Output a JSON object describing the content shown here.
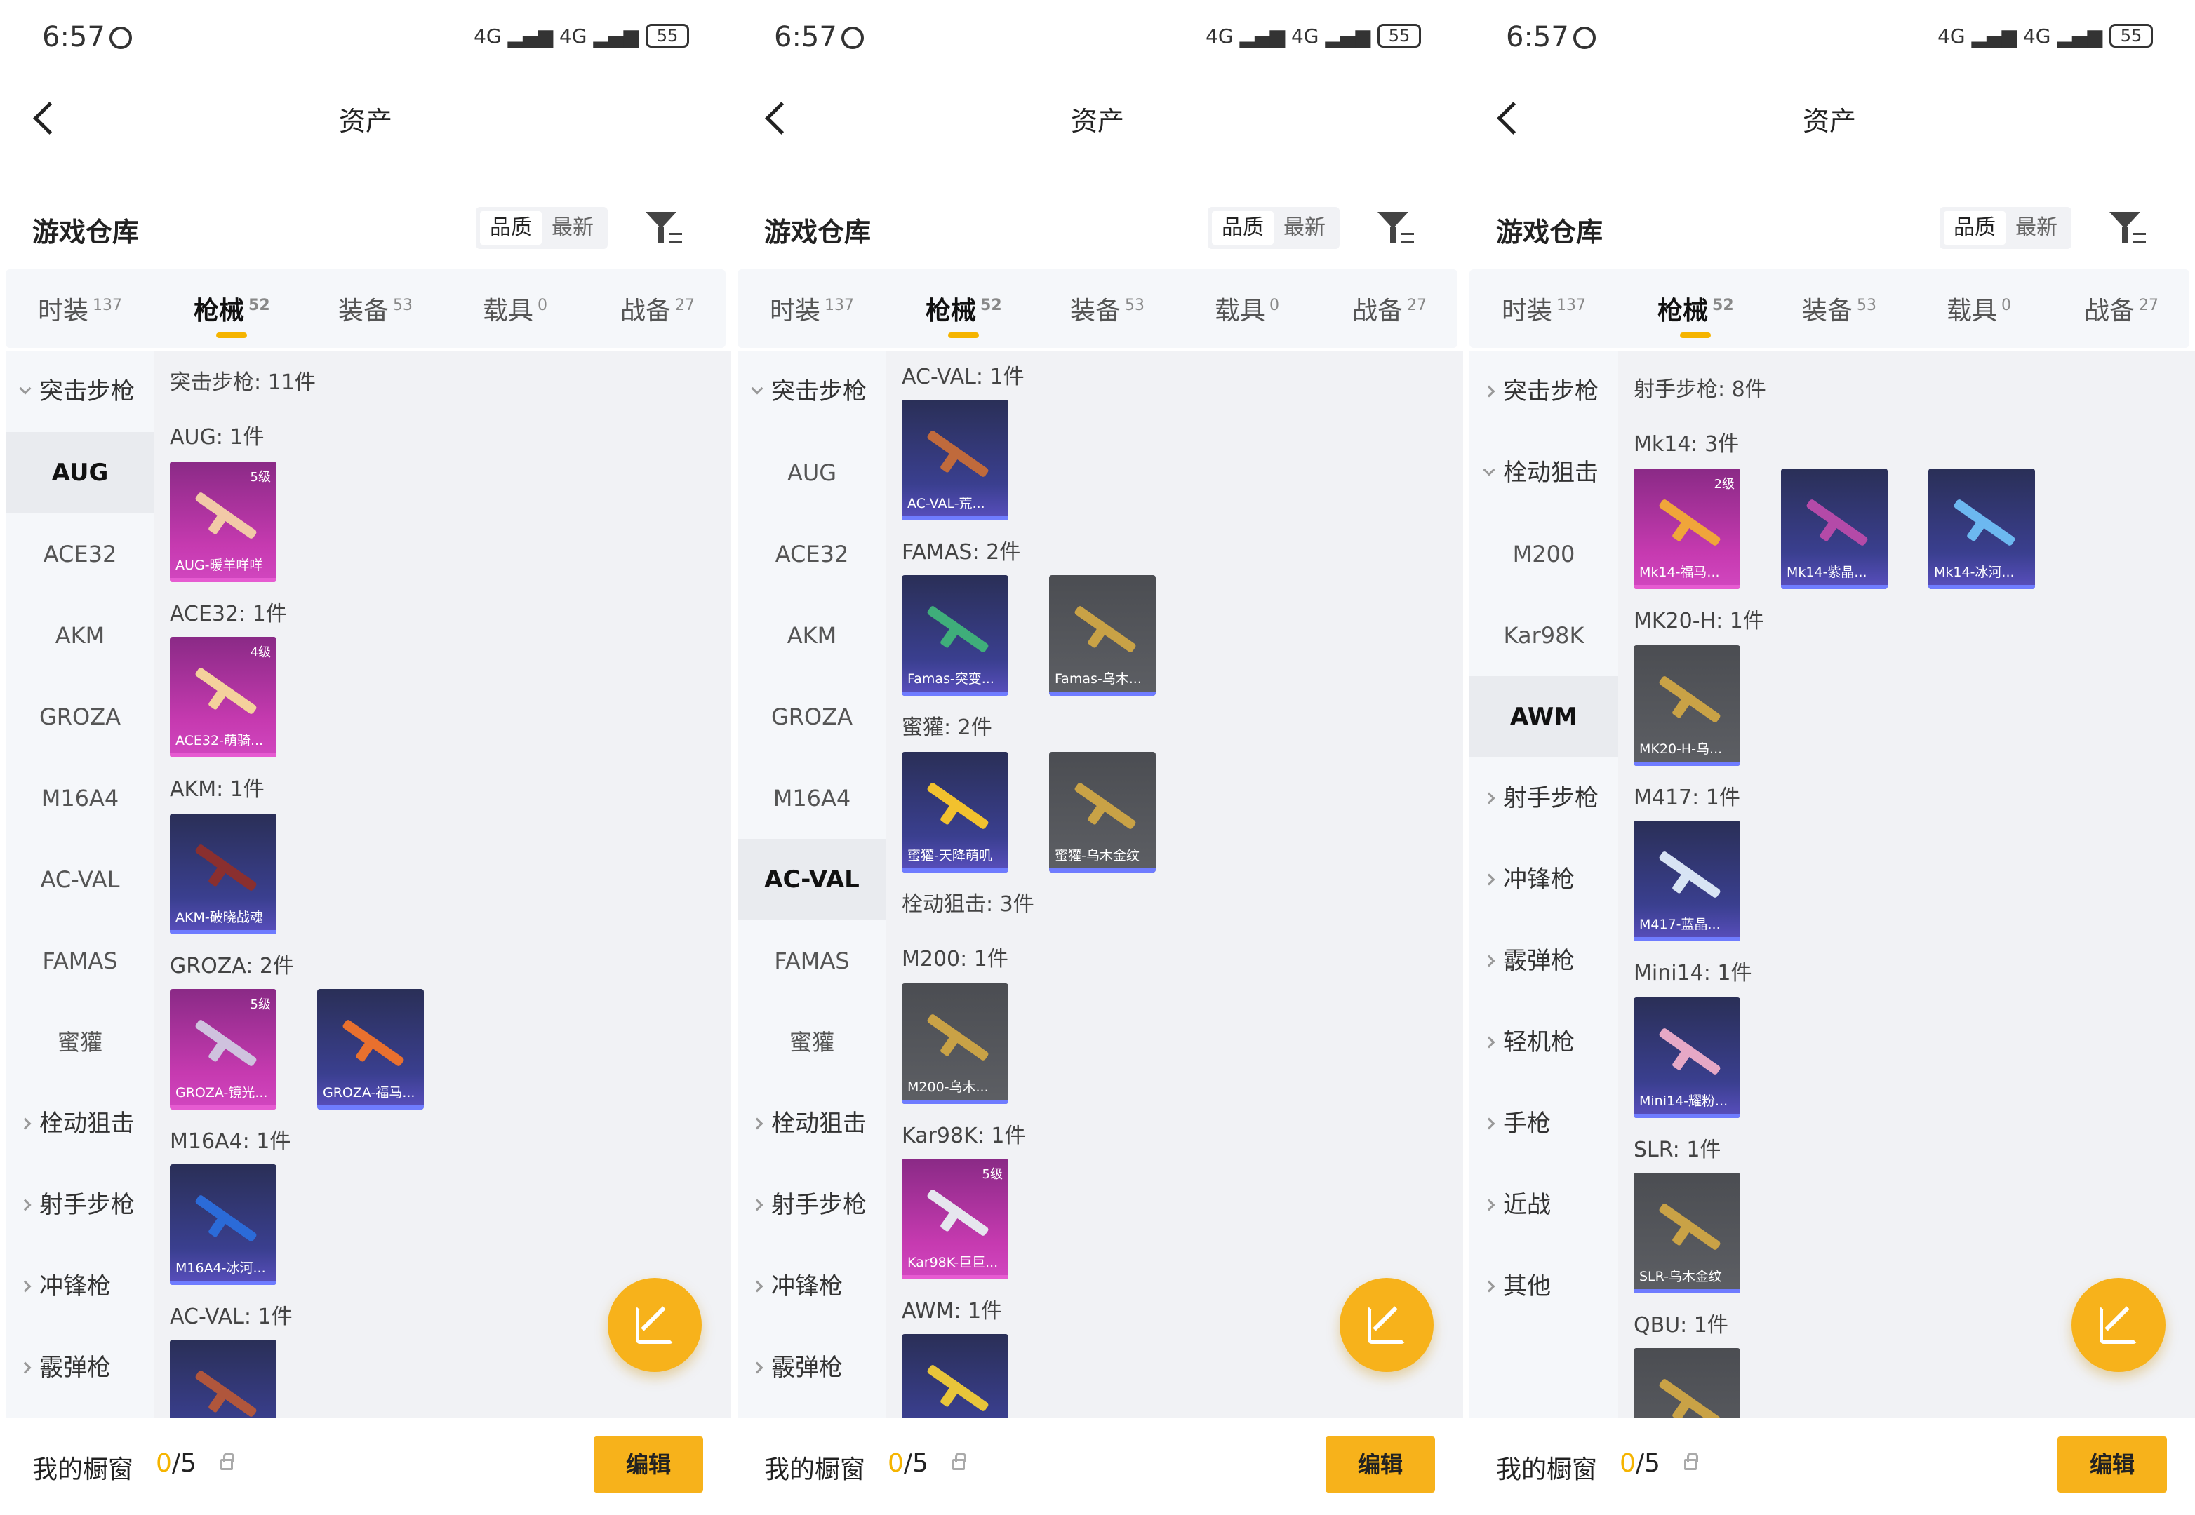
{
  "status": {
    "time": "6:57",
    "battery": "55",
    "signal": "4G ▂▄▆ 4G ▂▄▆"
  },
  "header": {
    "title": "资产"
  },
  "warehouse": {
    "title": "游戏仓库",
    "sort_quality": "品质",
    "sort_newest": "最新"
  },
  "tabs": [
    {
      "label": "时装",
      "count": "137"
    },
    {
      "label": "枪械",
      "count": "52"
    },
    {
      "label": "装备",
      "count": "53"
    },
    {
      "label": "载具",
      "count": "0"
    },
    {
      "label": "战备",
      "count": "27"
    }
  ],
  "footer": {
    "showcase": "我的橱窗",
    "count_current": "0",
    "count_total": "/5",
    "edit": "编辑"
  },
  "panels": [
    {
      "sidebar": [
        "突击步枪",
        "AUG",
        "ACE32",
        "AKM",
        "GROZA",
        "M16A4",
        "AC-VAL",
        "FAMAS",
        "蜜獾",
        "栓动狙击",
        "射手步枪",
        "冲锋枪",
        "霰弹枪"
      ],
      "content": {
        "section": "突击步枪: 11件",
        "groups": [
          {
            "label": "AUG: 1件",
            "cards": [
              {
                "name": "AUG-暖羊咩咩",
                "level": "5级"
              }
            ]
          },
          {
            "label": "ACE32: 1件",
            "cards": [
              {
                "name": "ACE32-萌骑...",
                "level": "4级"
              }
            ]
          },
          {
            "label": "AKM: 1件",
            "cards": [
              {
                "name": "AKM-破晓战魂",
                "level": ""
              }
            ]
          },
          {
            "label": "GROZA: 2件",
            "cards": [
              {
                "name": "GROZA-镜光...",
                "level": "5级"
              },
              {
                "name": "GROZA-福马...",
                "level": ""
              }
            ]
          },
          {
            "label": "M16A4: 1件",
            "cards": [
              {
                "name": "M16A4-冰河...",
                "level": ""
              }
            ]
          },
          {
            "label": "AC-VAL: 1件",
            "cards": [
              {
                "name": "",
                "level": ""
              }
            ]
          }
        ]
      }
    },
    {
      "sidebar": [
        "突击步枪",
        "AUG",
        "ACE32",
        "AKM",
        "GROZA",
        "M16A4",
        "AC-VAL",
        "FAMAS",
        "蜜獾",
        "栓动狙击",
        "射手步枪",
        "冲锋枪",
        "霰弹枪"
      ],
      "content": {
        "groups": [
          {
            "label": "AC-VAL: 1件",
            "cards": [
              {
                "name": "AC-VAL-荒...",
                "level": ""
              }
            ]
          },
          {
            "label": "FAMAS: 2件",
            "cards": [
              {
                "name": "Famas-突变...",
                "level": ""
              },
              {
                "name": "Famas-乌木...",
                "level": ""
              }
            ]
          },
          {
            "label": "蜜獾: 2件",
            "cards": [
              {
                "name": "蜜獾-天降萌叽",
                "level": ""
              },
              {
                "name": "蜜獾-乌木金纹",
                "level": ""
              }
            ]
          },
          {
            "label": "栓动狙击: 3件",
            "cards": []
          },
          {
            "label": "M200: 1件",
            "cards": [
              {
                "name": "M200-乌木...",
                "level": ""
              }
            ]
          },
          {
            "label": "Kar98K: 1件",
            "cards": [
              {
                "name": "Kar98K-巨巨...",
                "level": "5级"
              }
            ]
          },
          {
            "label": "AWM: 1件",
            "cards": [
              {
                "name": "",
                "level": ""
              }
            ]
          }
        ]
      }
    },
    {
      "sidebar": [
        "突击步枪",
        "栓动狙击",
        "M200",
        "Kar98K",
        "AWM",
        "射手步枪",
        "冲锋枪",
        "霰弹枪",
        "轻机枪",
        "手枪",
        "近战",
        "其他"
      ],
      "content": {
        "section": "射手步枪: 8件",
        "groups": [
          {
            "label": "Mk14: 3件",
            "cards": [
              {
                "name": "Mk14-福马...",
                "level": "2级"
              },
              {
                "name": "Mk14-紫晶...",
                "level": ""
              },
              {
                "name": "Mk14-冰河...",
                "level": ""
              }
            ]
          },
          {
            "label": "MK20-H: 1件",
            "cards": [
              {
                "name": "MK20-H-乌...",
                "level": ""
              }
            ]
          },
          {
            "label": "M417: 1件",
            "cards": [
              {
                "name": "M417-蓝晶...",
                "level": ""
              }
            ]
          },
          {
            "label": "Mini14: 1件",
            "cards": [
              {
                "name": "Mini14-耀粉...",
                "level": ""
              }
            ]
          },
          {
            "label": "SLR: 1件",
            "cards": [
              {
                "name": "SLR-乌木金纹",
                "level": ""
              }
            ]
          },
          {
            "label": "QBU: 1件",
            "cards": [
              {
                "name": "",
                "level": ""
              }
            ]
          }
        ]
      }
    }
  ]
}
